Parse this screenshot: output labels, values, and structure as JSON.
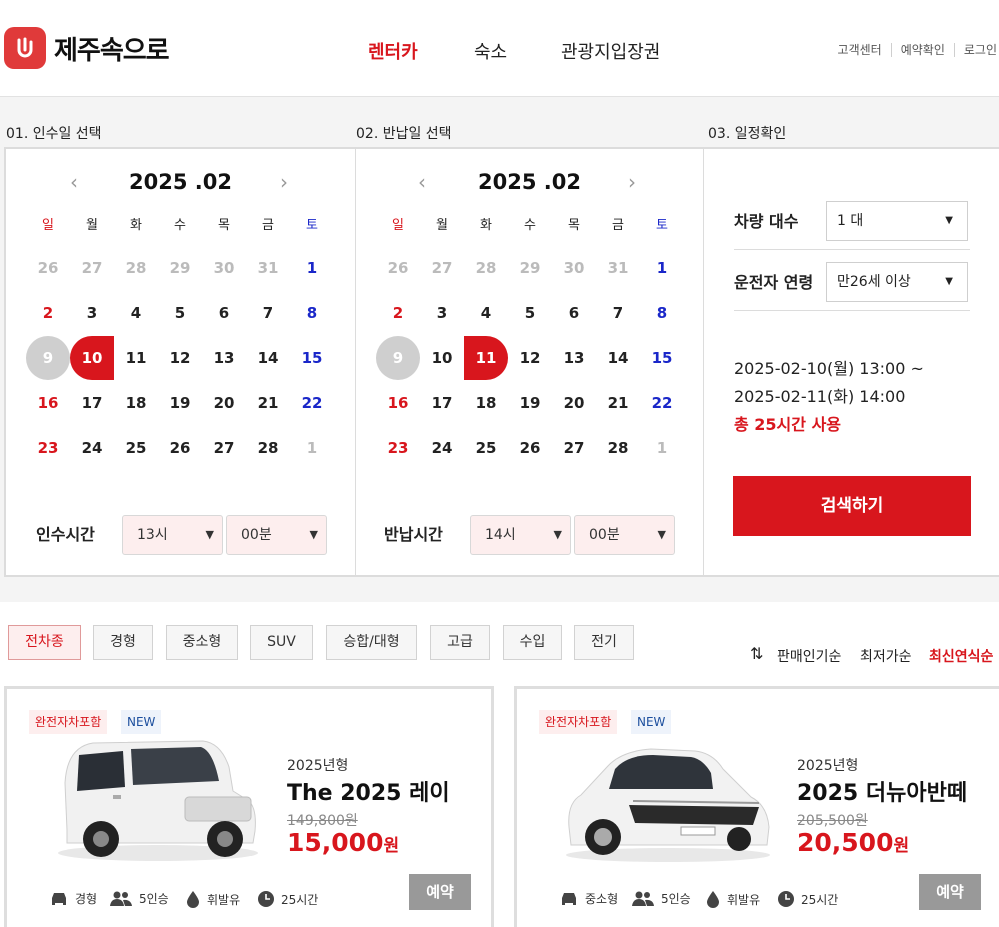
{
  "brand": {
    "name": "제주속으로",
    "color": "#e03a3a"
  },
  "nav": {
    "items": [
      "렌터카",
      "숙소",
      "관광지입장권"
    ],
    "active": "렌터카"
  },
  "util": [
    "고객센터",
    "예약확인",
    "로그인"
  ],
  "steps": [
    "01. 인수일 선택",
    "02. 반납일 선택",
    "03. 일정확인"
  ],
  "weekdays": [
    "일",
    "월",
    "화",
    "수",
    "목",
    "금",
    "토"
  ],
  "pickup_calendar": {
    "title": "2025 .02",
    "prev": "‹",
    "next": "›",
    "days": [
      "26",
      "27",
      "28",
      "29",
      "30",
      "31",
      "1",
      "2",
      "3",
      "4",
      "5",
      "6",
      "7",
      "8",
      "9",
      "10",
      "11",
      "12",
      "13",
      "14",
      "15",
      "16",
      "17",
      "18",
      "19",
      "20",
      "21",
      "22",
      "23",
      "24",
      "25",
      "26",
      "27",
      "28",
      "1"
    ],
    "today": "9",
    "selected": "10",
    "time_label": "인수시간",
    "hour": "13시",
    "minute": "00분"
  },
  "return_calendar": {
    "title": "2025 .02",
    "prev": "‹",
    "next": "›",
    "days": [
      "26",
      "27",
      "28",
      "29",
      "30",
      "31",
      "1",
      "2",
      "3",
      "4",
      "5",
      "6",
      "7",
      "8",
      "9",
      "10",
      "11",
      "12",
      "13",
      "14",
      "15",
      "16",
      "17",
      "18",
      "19",
      "20",
      "21",
      "22",
      "23",
      "24",
      "25",
      "26",
      "27",
      "28",
      "1"
    ],
    "today": "9",
    "selected": "11",
    "time_label": "반납시간",
    "hour": "14시",
    "minute": "00분"
  },
  "confirm": {
    "car_count_label": "차량 대수",
    "car_count": "1 대",
    "driver_age_label": "운전자 연령",
    "driver_age": "만26세 이상",
    "start": "2025-02-10(월) 13:00 ~",
    "end": "2025-02-11(화) 14:00",
    "total": "총 25시간 사용",
    "search": "검색하기"
  },
  "filters": [
    "전차종",
    "경형",
    "중소형",
    "SUV",
    "승합/대형",
    "고급",
    "수입",
    "전기"
  ],
  "filter_active": "전차종",
  "sort": {
    "options": [
      "판매인기순",
      "최저가순",
      "최신연식순"
    ],
    "active": "최신연식순",
    "icon": "sort-arrows-icon"
  },
  "cars": [
    {
      "badge1": "완전자차포함",
      "badge2": "NEW",
      "year": "2025년형",
      "model": "The 2025 레이",
      "old_price": "149,800원",
      "price": "15,000",
      "unit": "원",
      "class": "경형",
      "seats": "5인승",
      "fuel": "휘발유",
      "hours": "25시간",
      "reserve": "예약"
    },
    {
      "badge1": "완전자차포함",
      "badge2": "NEW",
      "year": "2025년형",
      "model": "2025 더뉴아반떼",
      "old_price": "205,500원",
      "price": "20,500",
      "unit": "원",
      "class": "중소형",
      "seats": "5인승",
      "fuel": "휘발유",
      "hours": "25시간",
      "reserve": "예약"
    }
  ],
  "colors": {
    "accent": "#d8161d",
    "muted": "#bbbbbb",
    "saturday": "#1a27c9"
  }
}
